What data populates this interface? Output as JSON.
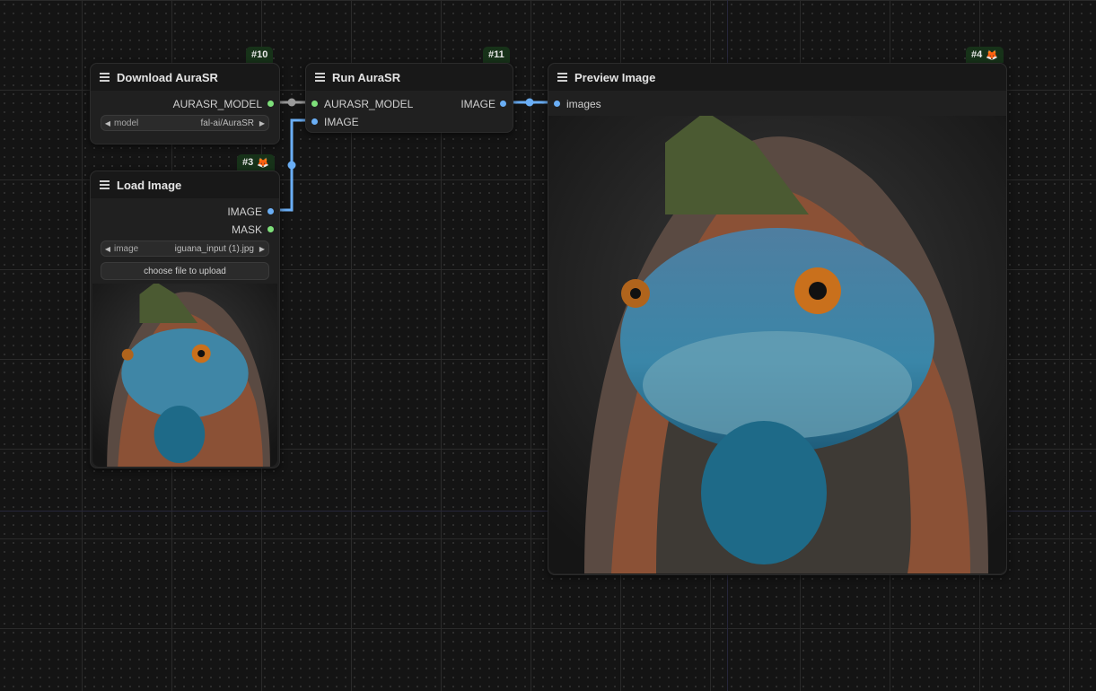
{
  "nodes": {
    "download": {
      "id_badge": "#10",
      "title": "Download AuraSR",
      "output": "AURASR_MODEL",
      "widget": {
        "label": "model",
        "value": "fal-ai/AuraSR"
      }
    },
    "run": {
      "id_badge": "#11",
      "title": "Run AuraSR",
      "inputs": [
        "AURASR_MODEL",
        "IMAGE"
      ],
      "output": "IMAGE"
    },
    "preview": {
      "id_badge": "#4",
      "title": "Preview Image",
      "input": "images"
    },
    "load": {
      "id_badge": "#3",
      "title": "Load Image",
      "outputs": [
        "IMAGE",
        "MASK"
      ],
      "widget": {
        "label": "image",
        "value": "iguana_input (1).jpg"
      },
      "upload_label": "choose file to upload"
    }
  },
  "colors": {
    "model_slot": "#7ee07a",
    "image_slot": "#6aaef5",
    "badge_bg": "#173219"
  },
  "icons": [
    "menu-icon",
    "fox-icon",
    "arrow-left-icon",
    "arrow-right-icon"
  ]
}
